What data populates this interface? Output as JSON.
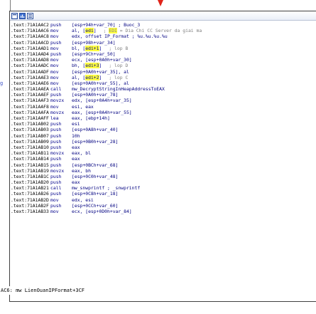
{
  "window": {
    "title_icons": [
      "window-icon",
      "chart-icon",
      "list-icon"
    ]
  },
  "rows": [
    {
      "addr": ".text:71A1AAC2",
      "mn": "push",
      "ops": "[esp+94h+var_70] ; Buoc_3"
    },
    {
      "addr": ".text:71A1AAC6",
      "mn": "mov",
      "ops": "al, [edi]",
      "comment": "; EDI = Dia Chi CC Server da giai ma"
    },
    {
      "addr": ".text:71A1AAC8",
      "mov": "",
      "mn": "mov",
      "ops": "edx, offset IP_Format ; %u.%u.%u.%u"
    },
    {
      "addr": ".text:71A1AACD",
      "mn": "push",
      "ops": "[esp+98h+var_34]"
    },
    {
      "addr": ".text:71A1AAD1",
      "mn": "mov",
      "ops": "bl, [edi+1]",
      "comment": "; lop B"
    },
    {
      "addr": ".text:71A1AAD4",
      "mn": "push",
      "ops": "[esp+9Ch+var_50]"
    },
    {
      "addr": ".text:71A1AAD8",
      "mn": "mov",
      "ops": "ecx, [esp+0A0h+var_30]"
    },
    {
      "addr": ".text:71A1AADC",
      "mn": "mov",
      "ops": "bh, [edi+3]",
      "comment": "; lop D"
    },
    {
      "addr": ".text:71A1AADF",
      "mn": "mov",
      "ops": "[esp+0A0h+var_35], al"
    },
    {
      "addr": ".text:71A1AAE3",
      "mn": "mov",
      "ops": "al, [edi+2]",
      "comment": "; lop C"
    },
    {
      "addr": ".text:71A1AAE6",
      "mn": "mov",
      "ops": "[esp+0A0h+var_55], al"
    },
    {
      "addr": ".text:71A1AAEA",
      "mn": "call",
      "ops": "mw_DecryptStringInHeapAddressToEAX"
    },
    {
      "addr": ".text:71A1AAEF",
      "mn": "push",
      "ops": "[esp+0A0h+var_78]"
    },
    {
      "addr": ".text:71A1AAF3",
      "mn": "movzx",
      "ops": "edx, [esp+0A4h+var_35]"
    },
    {
      "addr": ".text:71A1AAF8",
      "mn": "mov",
      "ops": "esi, eax"
    },
    {
      "addr": ".text:71A1AAFA",
      "mn": "movzx",
      "ops": "eax, [esp+0A4h+var_55]"
    },
    {
      "addr": ".text:71A1AAFF",
      "mn": "lea",
      "ops": "eax, [ebp+14h]"
    },
    {
      "addr": ".text:71A1AB02",
      "mn": "push",
      "ops": "esi"
    },
    {
      "addr": ".text:71A1AB03",
      "mn": "push",
      "ops": "[esp+0A8h+var_40]"
    },
    {
      "addr": ".text:71A1AB07",
      "mn": "push",
      "ops": "10h"
    },
    {
      "addr": ".text:71A1AB09",
      "mn": "push",
      "ops": "[esp+0B0h+var_28]"
    },
    {
      "addr": ".text:71A1AB10",
      "mn": "push",
      "ops": "eax"
    },
    {
      "addr": ".text:71A1AB11",
      "mn": "movzx",
      "ops": "eax, bl"
    },
    {
      "addr": ".text:71A1AB14",
      "mn": "push",
      "ops": "eax"
    },
    {
      "addr": ".text:71A1AB15",
      "mn": "push",
      "ops": "[esp+0BCh+var_68]"
    },
    {
      "addr": ".text:71A1AB19",
      "mn": "movzx",
      "ops": "eax, bh"
    },
    {
      "addr": ".text:71A1AB1C",
      "mn": "push",
      "ops": "[esp+0C0h+var_48]"
    },
    {
      "addr": ".text:71A1AB20",
      "mn": "push",
      "ops": "eax"
    },
    {
      "addr": ".text:71A1AB21",
      "mn": "call",
      "ops": "mw_snwprintf ; _snwprintf"
    },
    {
      "addr": ".text:71A1AB26",
      "mn": "push",
      "ops": "[esp+0C8h+var_18]"
    },
    {
      "addr": ".text:71A1AB2D",
      "mn": "mov",
      "ops": "edx, esi"
    },
    {
      "addr": ".text:71A1AB2F",
      "mn": "push",
      "ops": "[esp+0CCh+var_60]"
    },
    {
      "addr": ".text:71A1AB33",
      "mn": "mov",
      "ops": "ecx, [esp+0D0h+var_84]"
    }
  ],
  "footer": {
    "text": "AC6: mw LienOuanIPFormat+3CF"
  }
}
